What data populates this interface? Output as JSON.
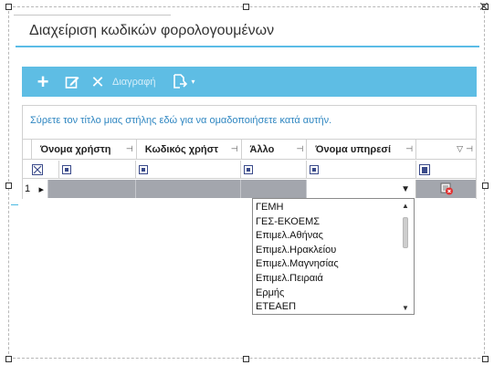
{
  "window": {
    "close_glyph": "✕"
  },
  "title": "Διαχείριση κωδικών φορολογουμένων",
  "toolbar": {
    "add_icon": "+",
    "edit_icon": "edit-icon",
    "delete_icon": "✕",
    "delete_label": "Διαγραφή",
    "export_icon": "export-icon",
    "export_caret": "▾"
  },
  "grid": {
    "group_hint": "Σύρετε τον τίτλο μιας στήλης εδώ για να ομαδοποιήσετε κατά αυτήν.",
    "columns": [
      "Όνομα χρήστη",
      "Κωδικός χρήστ",
      "Άλλο",
      "Όνομα υπηρεσί",
      ""
    ],
    "pin_glyph": "⊣",
    "filter_glyph": "▽",
    "row_number": "1",
    "row_indicator": "▸",
    "dropdown_caret": "▼"
  },
  "dropdown": {
    "items": [
      "ΓΕΜΗ",
      "ΓΕΣ-ΕΚΟΕΜΣ",
      "Επιμελ.Αθήνας",
      "Επιμελ.Ηρακλείου",
      "Επιμελ.Μαγνησίας",
      "Επιμελ.Πειραιά",
      "Ερμής",
      "ΕΤΕΑΕΠ"
    ],
    "scroll_up": "▲",
    "scroll_down": "▼"
  },
  "colors": {
    "accent": "#5ebde4",
    "link": "#2e86c1",
    "row_selected": "#a3a6ad"
  }
}
